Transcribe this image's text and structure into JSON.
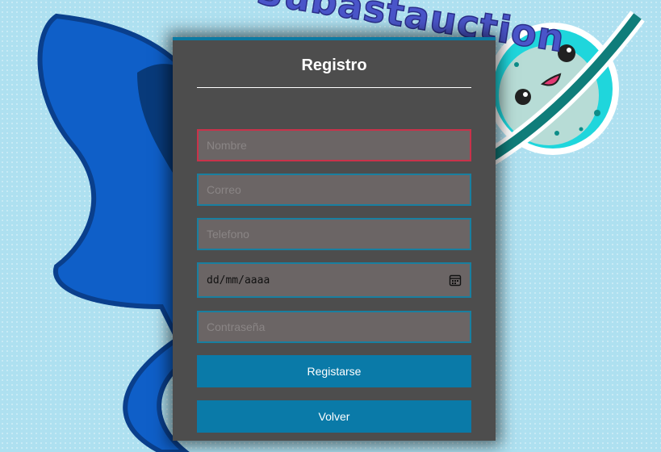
{
  "brand": {
    "logo_text": "Subastauction"
  },
  "form": {
    "title": "Registro",
    "fields": {
      "name_placeholder": "Nombre",
      "email_placeholder": "Correo",
      "phone_placeholder": "Telefono",
      "date_placeholder": "dd/mm/aaaa",
      "password_placeholder": "Contraseña"
    },
    "buttons": {
      "register_label": "Registarse",
      "back_label": "Volver"
    }
  },
  "colors": {
    "panel_bg": "#4d4d4d",
    "field_bg": "#6b6565",
    "field_border": "#197fa0",
    "active_border": "#c9324a",
    "button_bg": "#0a7aa8",
    "page_bg": "#aee0f0"
  },
  "icons": {
    "date_picker": "calendar-icon"
  }
}
